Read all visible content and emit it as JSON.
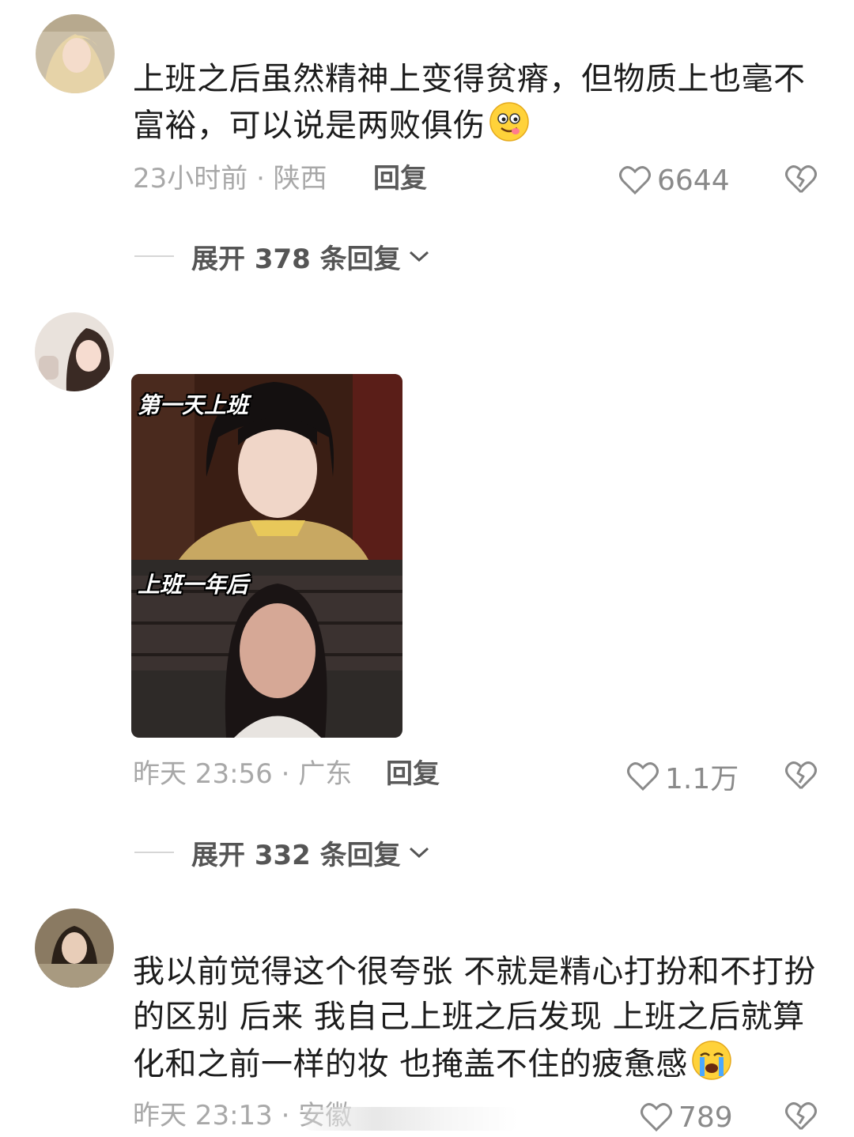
{
  "comments": [
    {
      "text": "上班之后虽然精神上变得贫瘠，但物质上也毫不富裕，可以说是两败俱伤",
      "emoji": "yum-face-emoji",
      "time_location": "23小时前 · 陕西",
      "reply_label": "回复",
      "likes": "6644",
      "expand_label": "展开 378 条回复"
    },
    {
      "meme_captions": [
        "第一天上班",
        "上班一年后"
      ],
      "time_location": "昨天 23:56 · 广东",
      "reply_label": "回复",
      "likes": "1.1万",
      "expand_label": "展开 332 条回复"
    },
    {
      "text": "我以前觉得这个很夸张 不就是精心打扮和不打扮的区别 后来 我自己上班之后发现 上班之后就算化和之前一样的妆 也掩盖不住的疲惫感",
      "emoji": "crying-face-emoji",
      "time_location": "昨天 23:13 · 安徽",
      "likes": "789"
    }
  ],
  "colors": {
    "meta_gray": "#a8a8a8",
    "icon_gray": "#8a8a8a"
  }
}
